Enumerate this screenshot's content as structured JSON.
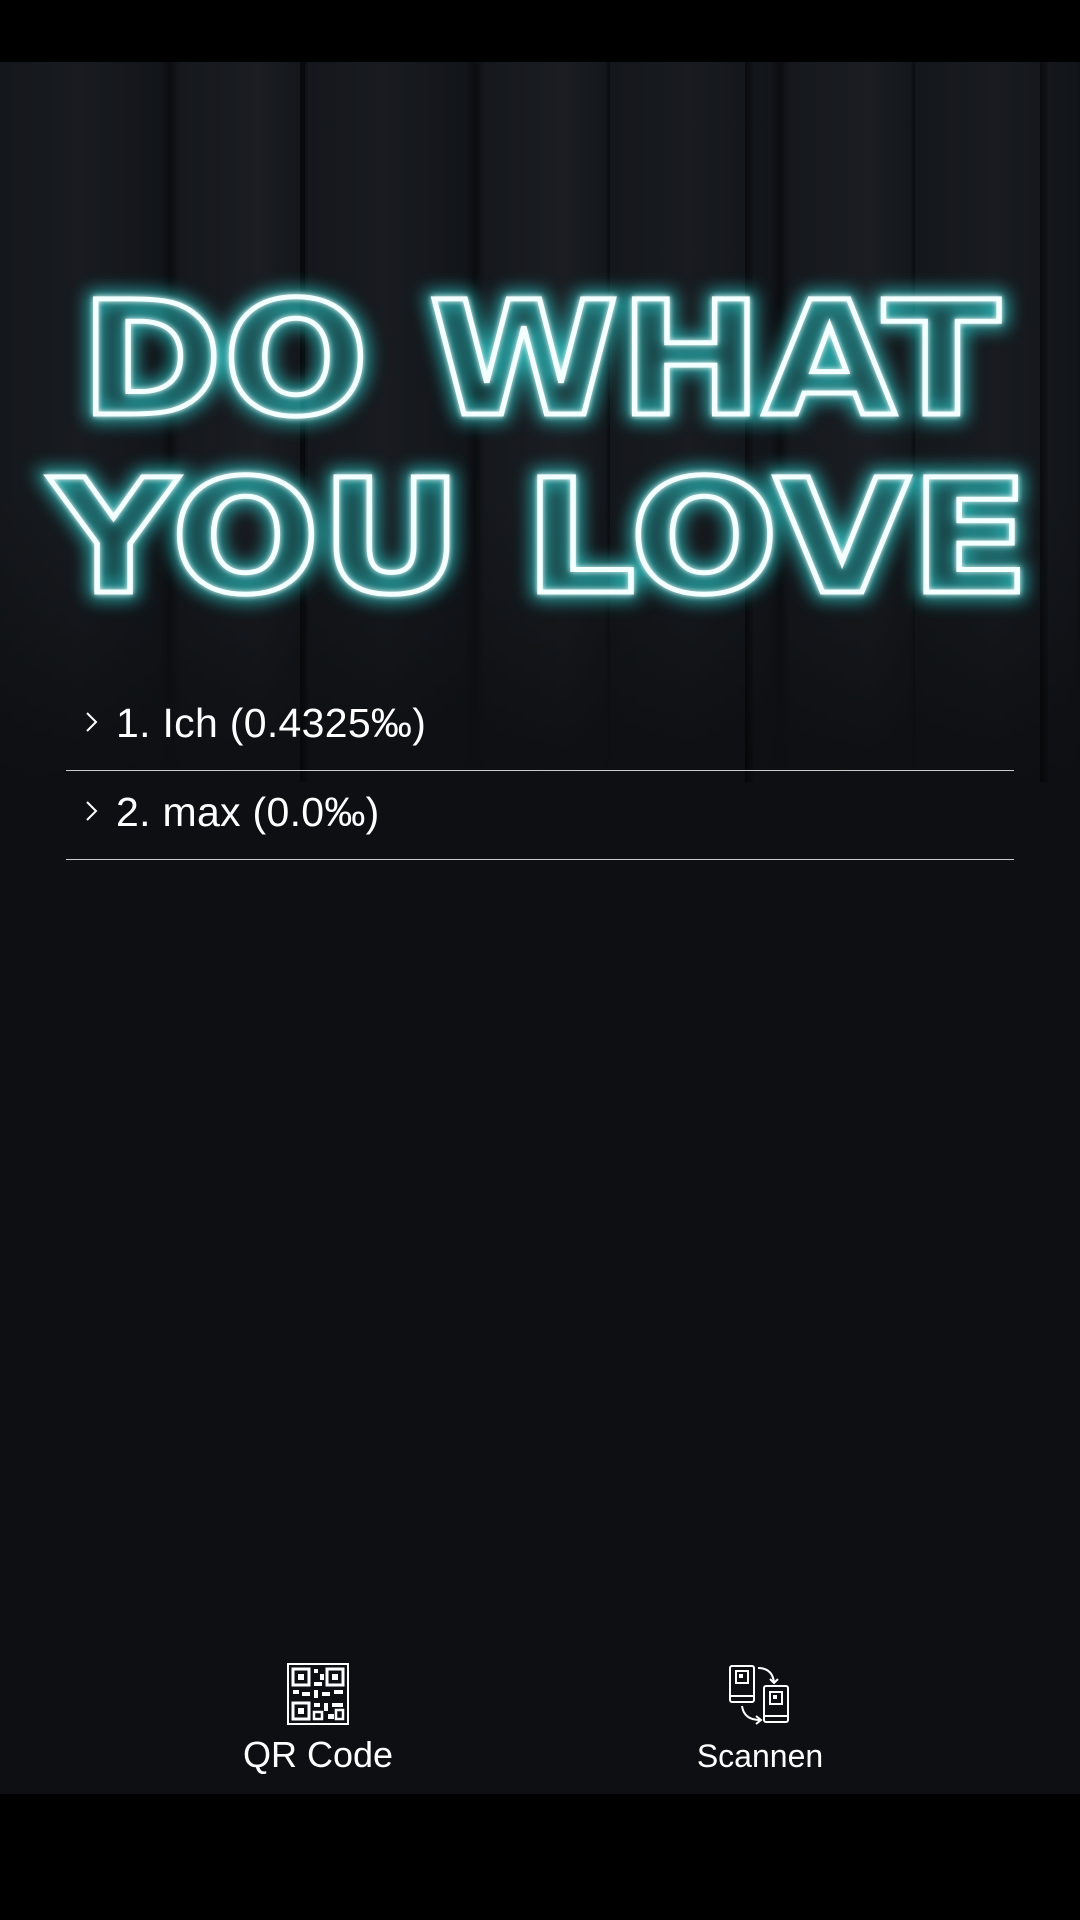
{
  "hero": {
    "sign_line_1": "DO WHAT",
    "sign_line_2": "YOU LOVE",
    "neon_color": "#2fd6d6"
  },
  "list": {
    "items": [
      {
        "label": "1. Ich (0.4325‰)",
        "icon": "chevron-right-icon"
      },
      {
        "label": "2. max (0.0‰)",
        "icon": "chevron-right-icon"
      }
    ]
  },
  "bottom_bar": {
    "qr_label": "QR Code",
    "qr_icon": "qr-code-icon",
    "scan_label": "Scannen",
    "scan_icon": "device-sync-icon"
  },
  "colors": {
    "background": "#0d0f12",
    "divider": "#c9cbcd",
    "text": "#ffffff"
  }
}
